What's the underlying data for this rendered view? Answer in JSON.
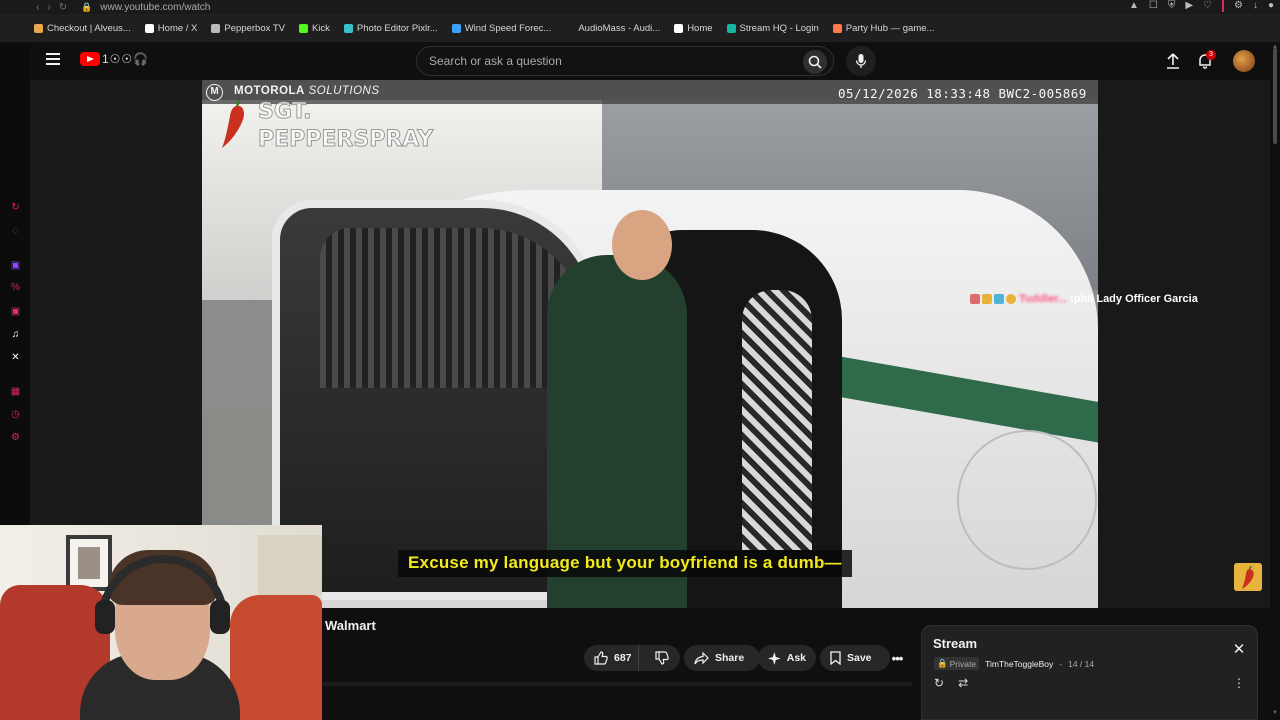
{
  "browser": {
    "url": "www.youtube.com/watch",
    "bookmarks": [
      {
        "label": "Checkout | Alveus...",
        "color": "#e7a74a"
      },
      {
        "label": "Home / X",
        "color": "#ffffff"
      },
      {
        "label": "Pepperbox TV",
        "color": "#bbbbbb"
      },
      {
        "label": "Kick",
        "color": "#53fc18"
      },
      {
        "label": "Photo Editor Pixlr...",
        "color": "#39c2c9"
      },
      {
        "label": "Wind Speed Forec...",
        "color": "#3ba3ff"
      },
      {
        "label": "AudioMass - Audi...",
        "color": "#1f1f1f"
      },
      {
        "label": "Home",
        "color": "#ffffff"
      },
      {
        "label": "Stream HQ - Login",
        "color": "#17b3a3"
      },
      {
        "label": "Party Hub — game...",
        "color": "#ff7a4a"
      }
    ]
  },
  "header": {
    "search_placeholder": "Search or ask a question",
    "notification_count": "3",
    "logo_doodle": "1☉☉🎧"
  },
  "video": {
    "overlay_brand_bold": "MOTOROLA",
    "overlay_brand_italic": "SOLUTIONS",
    "timestamp": "05/12/2026 18:33:48 BWC2-005869",
    "watermark_line1": "SGT.",
    "watermark_line2": "PEPPERSPRAY",
    "caption": "Excuse my language but your boyfriend is a dumb—",
    "chat_user": "Tuddler...",
    "chat_message": "!phil Lady Officer Garcia",
    "seal": "M"
  },
  "below": {
    "title": "Walmart",
    "like_count": "687",
    "share_label": "Share",
    "ask_label": "Ask",
    "save_label": "Save"
  },
  "playlist": {
    "title": "Stream",
    "privacy": "Private",
    "owner": "TimTheToggleBoy",
    "position": "14 / 14"
  },
  "colors": {
    "caption_text": "#f3ea1c",
    "brand_red": "#ff0000",
    "badge_red": "#cc0000"
  }
}
